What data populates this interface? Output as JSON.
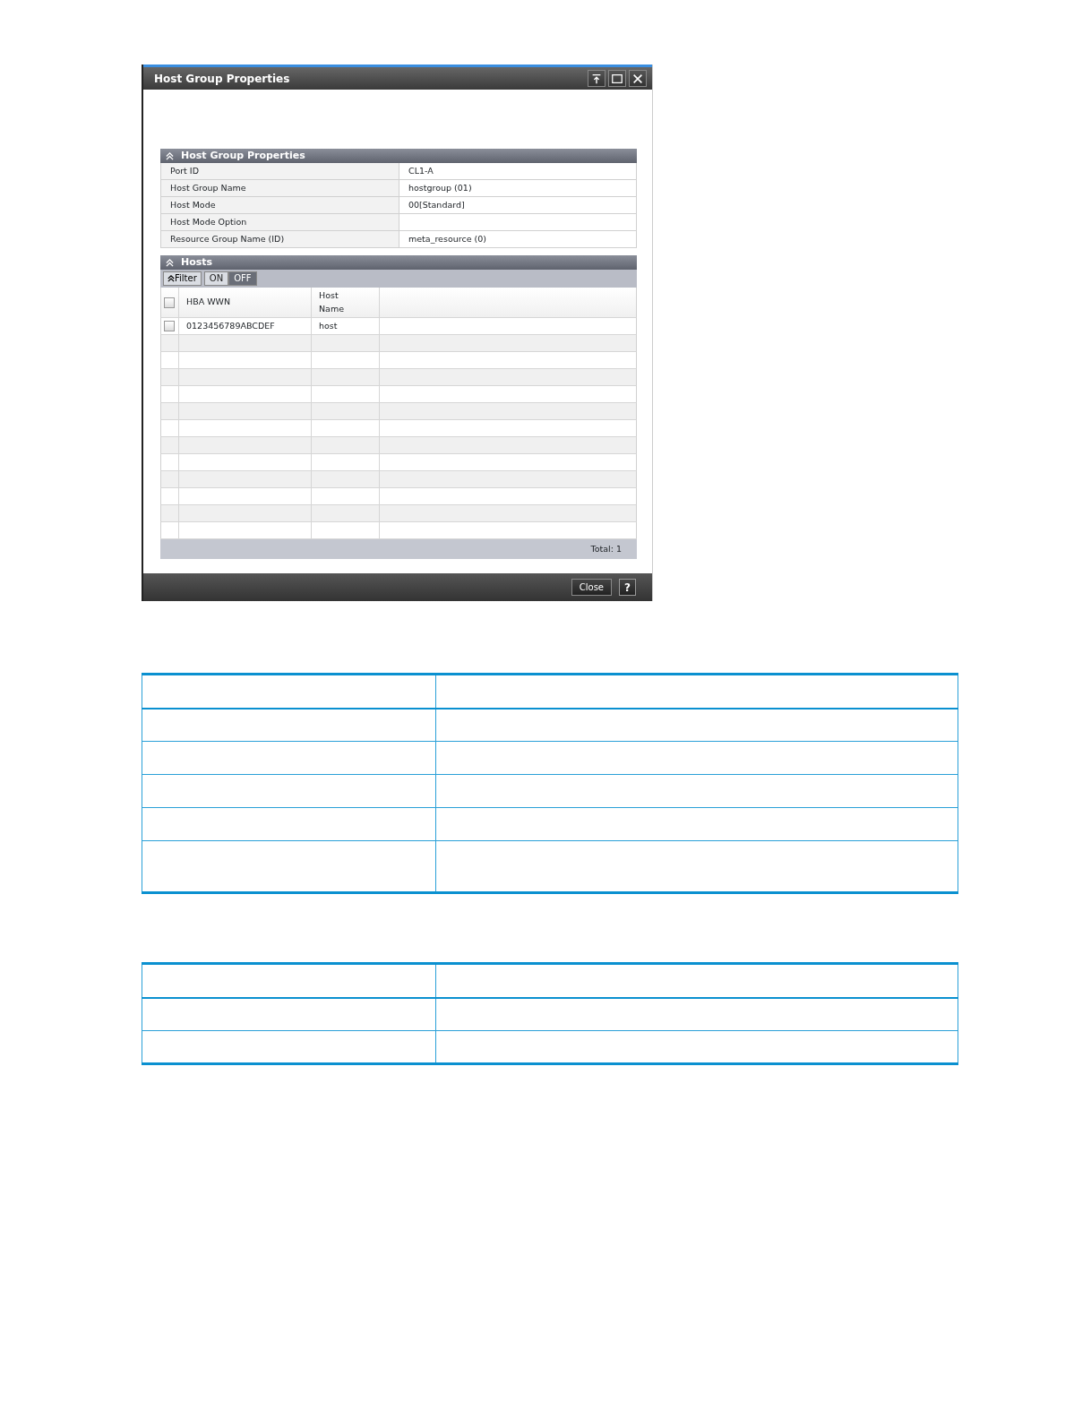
{
  "window": {
    "title": "Host Group Properties"
  },
  "properties": {
    "title": "Host Group Properties",
    "rows": [
      {
        "label": "Port ID",
        "value": "CL1-A"
      },
      {
        "label": "Host Group Name",
        "value": "hostgroup (01)"
      },
      {
        "label": "Host Mode",
        "value": "00[Standard]"
      },
      {
        "label": "Host Mode Option",
        "value": ""
      },
      {
        "label": "Resource Group Name (ID)",
        "value": "meta_resource (0)"
      }
    ]
  },
  "hosts": {
    "title": "Hosts",
    "filter": {
      "label": "Filter",
      "options": [
        {
          "label": "ON",
          "selected": false
        },
        {
          "label": "OFF",
          "selected": true
        }
      ]
    },
    "header_checkbox": {
      "checked": false
    },
    "columns": [
      "HBA WWN",
      "Host Name"
    ],
    "rows": [
      {
        "checked": false,
        "cells": [
          "0123456789ABCDEF",
          "host"
        ]
      }
    ],
    "total": "Total:  1"
  },
  "footer": {
    "buttons": [
      "Close",
      "?"
    ]
  }
}
